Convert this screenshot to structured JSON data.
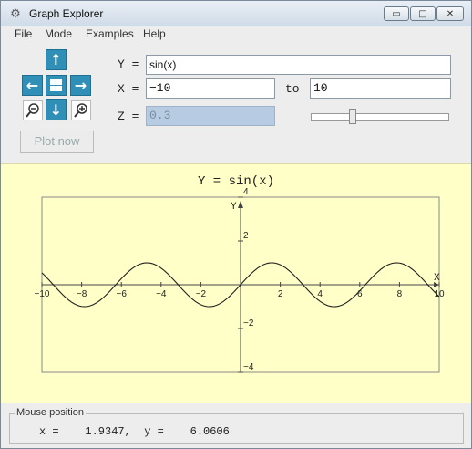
{
  "window": {
    "title": "Graph Explorer",
    "icon": "graph-app-icon",
    "controls": {
      "minimize": "▭",
      "maximize": "□",
      "close": "✕"
    }
  },
  "menu": [
    "File",
    "Mode",
    "Examples",
    "Help"
  ],
  "nav": {
    "up": "↑",
    "down": "↓",
    "left": "←",
    "right": "→",
    "center": "✣",
    "zoom_out": "zoom-out-icon",
    "zoom_in": "zoom-in-icon"
  },
  "form": {
    "y_label": "Y =",
    "y_value": "sin(x)",
    "x_label": "X =",
    "x_from": "−10",
    "to_label": "to",
    "x_to": "10",
    "z_label": "Z =",
    "z_value": "0.3",
    "plot_button": "Plot now"
  },
  "plot": {
    "title": "Y = sin(x)",
    "x_axis_label": "X",
    "y_axis_label": "Y",
    "x_ticks": [
      "−10",
      "−8",
      "−6",
      "−4",
      "−2",
      "2",
      "4",
      "6",
      "8",
      "10"
    ],
    "y_ticks": [
      "4",
      "2",
      "−2",
      "−4"
    ]
  },
  "chart_data": {
    "type": "line",
    "function": "sin(x)",
    "xlim": [
      -10,
      10
    ],
    "ylim": [
      -4,
      4
    ],
    "x_ticks": [
      -10,
      -8,
      -6,
      -4,
      -2,
      2,
      4,
      6,
      8,
      10
    ],
    "y_ticks": [
      4,
      2,
      -2,
      -4
    ],
    "xlabel": "X",
    "ylabel": "Y",
    "title": "Y = sin(x)",
    "grid": false
  },
  "status": {
    "legend": "Mouse position",
    "text": "x =    1.9347,  y =    6.0606"
  },
  "colors": {
    "nav_button": "#2f8fb7",
    "plot_background": "#ffffc8",
    "disabled_field": "#b7cce2"
  }
}
